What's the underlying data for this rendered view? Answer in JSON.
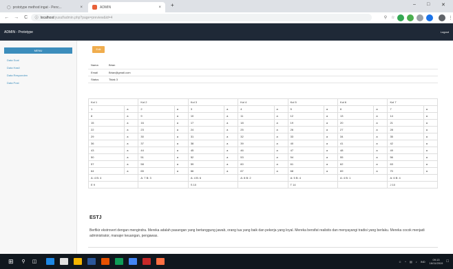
{
  "browser": {
    "tabs": [
      {
        "title": "prototype method ingat - Penc..."
      },
      {
        "title": "ADMIN"
      }
    ],
    "new_tab": "+",
    "url_host": "localhost",
    "url_path": "/yusuf/admin.php?page=preview&id=4"
  },
  "app": {
    "brand": "ADMIN - Prototype",
    "logout": "Logout"
  },
  "sidebar": {
    "menu_header": "MENU",
    "items": [
      {
        "label": "Data Soal"
      },
      {
        "label": "Data Hasil"
      },
      {
        "label": "Data Responden"
      },
      {
        "label": "Data Post"
      }
    ]
  },
  "content": {
    "edit_button": "Edit",
    "info": [
      {
        "label": "Nama",
        "value": "Brian"
      },
      {
        "label": "Email",
        "value": "Brian@gmail.com"
      },
      {
        "label": "Status",
        "value": "Tidak 3"
      }
    ],
    "score_headers": [
      "Kol 1",
      "Kol 2",
      "Kol 3",
      "Kol 4",
      "Kol 5",
      "Kol 6",
      "Kol 7"
    ],
    "score_rows": [
      [
        "1",
        "a",
        "2",
        "a",
        "3",
        "a",
        "4",
        "a",
        "5",
        "a",
        "6",
        "a",
        "7",
        "a"
      ],
      [
        "8",
        "a",
        "9",
        "a",
        "10",
        "a",
        "11",
        "a",
        "12",
        "a",
        "13",
        "a",
        "14",
        "a"
      ],
      [
        "15",
        "a",
        "16",
        "a",
        "17",
        "a",
        "18",
        "a",
        "19",
        "a",
        "20",
        "a",
        "21",
        "a"
      ],
      [
        "22",
        "a",
        "23",
        "a",
        "24",
        "a",
        "25",
        "a",
        "26",
        "a",
        "27",
        "a",
        "28",
        "a"
      ],
      [
        "29",
        "a",
        "30",
        "a",
        "31",
        "a",
        "32",
        "a",
        "33",
        "a",
        "34",
        "a",
        "35",
        "a"
      ],
      [
        "36",
        "a",
        "37",
        "a",
        "38",
        "a",
        "39",
        "a",
        "40",
        "a",
        "41",
        "a",
        "42",
        "a"
      ],
      [
        "43",
        "a",
        "44",
        "a",
        "45",
        "a",
        "46",
        "a",
        "47",
        "a",
        "48",
        "a",
        "49",
        "a"
      ],
      [
        "50",
        "a",
        "51",
        "a",
        "52",
        "a",
        "53",
        "a",
        "54",
        "a",
        "55",
        "a",
        "56",
        "a"
      ],
      [
        "57",
        "a",
        "58",
        "a",
        "59",
        "a",
        "60",
        "a",
        "61",
        "a",
        "62",
        "a",
        "63",
        "a"
      ],
      [
        "64",
        "a",
        "65",
        "a",
        "66",
        "a",
        "67",
        "a",
        "68",
        "a",
        "69",
        "a",
        "70",
        "a"
      ]
    ],
    "totals_row": [
      "A: 4 B: 4",
      "A: 7 B: 3",
      "A: 4 B: 6",
      "A: 8 B: 2",
      "A: 5 B: 4",
      "A: 4 B: 1",
      "A: 6 B: 4"
    ],
    "result_row": [
      "E 9",
      "",
      "S 10",
      "",
      "T 14",
      "",
      "J 10"
    ],
    "result_title": "ESTJ",
    "result_desc": "Berfikir ekstrovert dengan mengindra. Mereka adalah pasangan yang bertanggung jawab, orang tua yang baik dan pekerja yang loyal. Mereka bersifat realistis dan menyayangi tradisi yang berlaku. Mereka cocok menjadi administrator, manajer keuangan, pengawas."
  },
  "taskbar": {
    "lang": "IND",
    "time": "09:13",
    "date": "16/11/2019"
  },
  "colors": {
    "tabbar": "#dee1e6",
    "appbar": "#1f2937",
    "accent": "#3c8dbc",
    "edit": "#f0ad4e",
    "taskbar": "#10171e"
  }
}
